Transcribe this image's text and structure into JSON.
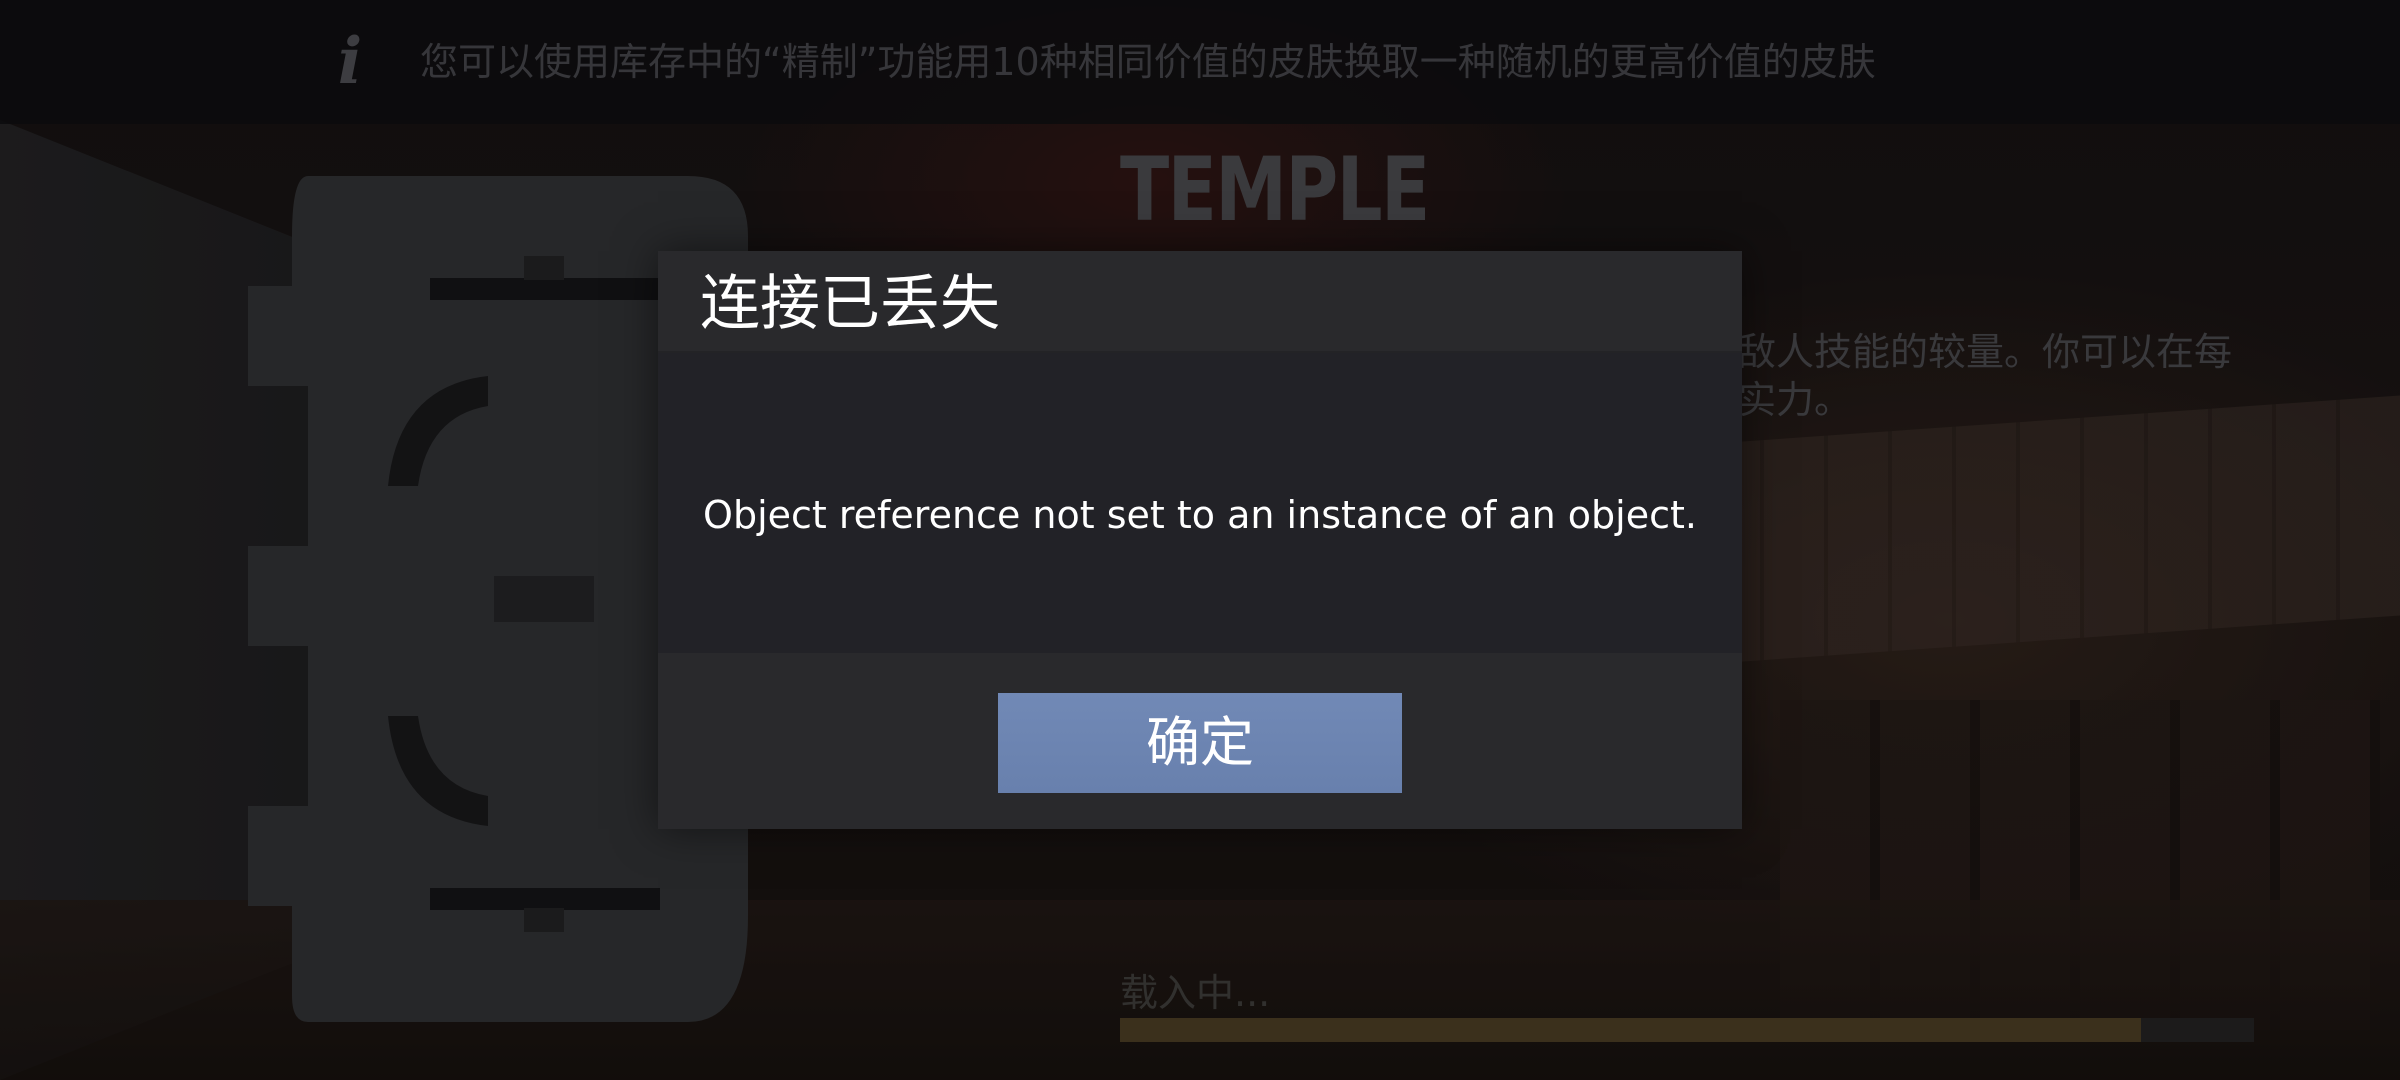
{
  "info_bar": {
    "icon": "info-icon",
    "text": "您可以使用库存中的“精制”功能用10种相同价值的皮肤换取一种随机的更高价值的皮肤"
  },
  "map": {
    "title": "TEMPLE",
    "description_line_1": "敌人技能的较量。你可以在每",
    "description_line_2": "实力。"
  },
  "emblem": {
    "icon": "game-mode-emblem-icon"
  },
  "loading": {
    "label": "载入中...",
    "progress": 0.9
  },
  "dialog": {
    "title": "连接已丢失",
    "message": "Object reference not set to an instance of an object.",
    "ok_label": "确定"
  },
  "colors": {
    "dialog_background": "#2a2a2e",
    "button_accent": "#6e86b3",
    "progress_fill": "#5b4a2b"
  }
}
